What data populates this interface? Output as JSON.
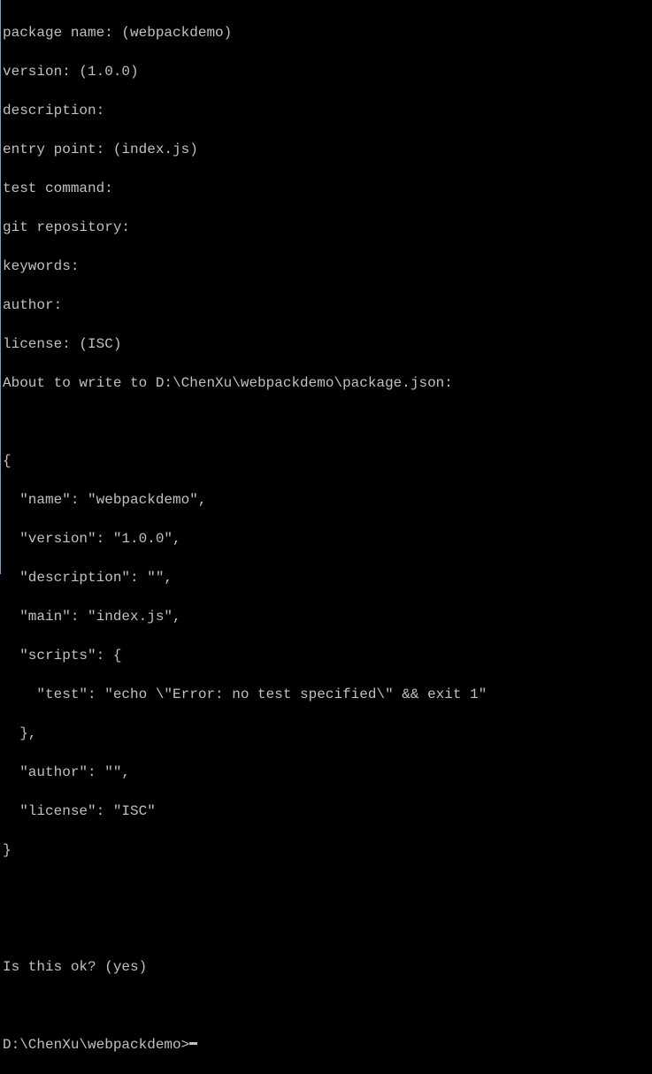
{
  "prompts": {
    "package_name": "package name: (webpackdemo)",
    "version": "version: (1.0.0)",
    "description": "description:",
    "entry_point": "entry point: (index.js)",
    "test_command": "test command:",
    "git_repository": "git repository:",
    "keywords": "keywords:",
    "author": "author:",
    "license": "license: (ISC)",
    "about_to_write": "About to write to D:\\ChenXu\\webpackdemo\\package.json:"
  },
  "json_preview": {
    "open_brace": "{",
    "name": "  \"name\": \"webpackdemo\",",
    "version": "  \"version\": \"1.0.0\",",
    "description": "  \"description\": \"\",",
    "main": "  \"main\": \"index.js\",",
    "scripts_open": "  \"scripts\": {",
    "test": "    \"test\": \"echo \\\"Error: no test specified\\\" && exit 1\"",
    "scripts_close": "  },",
    "author": "  \"author\": \"\",",
    "license": "  \"license\": \"ISC\"",
    "close_brace": "}"
  },
  "confirm": "Is this ok? (yes)",
  "cwd_prompt": "D:\\ChenXu\\webpackdemo>"
}
